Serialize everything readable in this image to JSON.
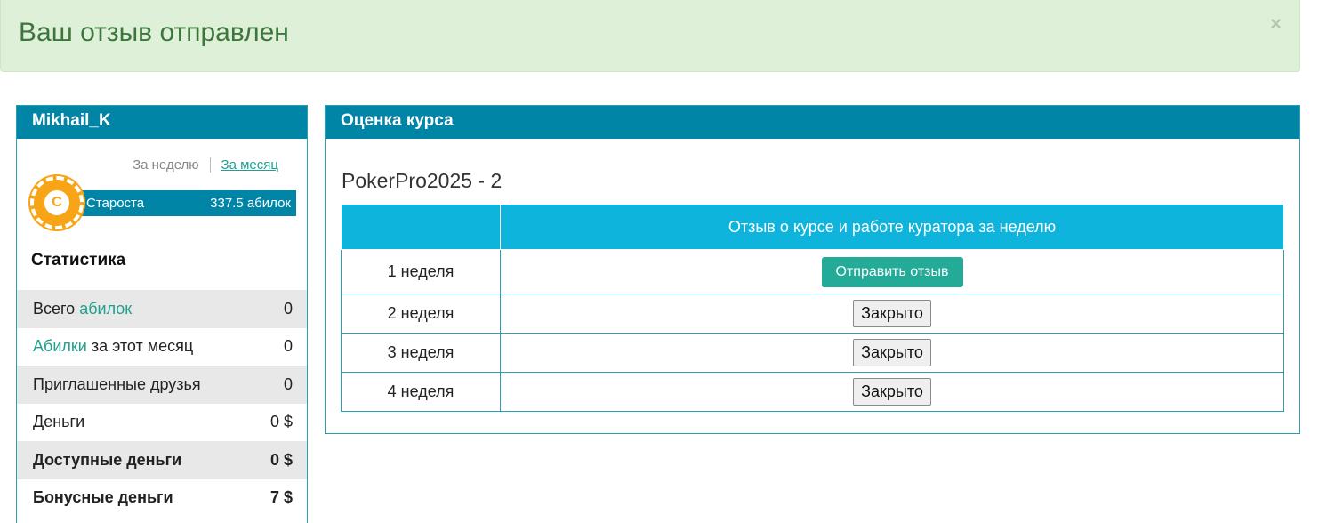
{
  "alert": {
    "message": "Ваш отзыв отправлен",
    "close": "×"
  },
  "user": {
    "name": "Mikhail_K",
    "period_tabs": {
      "week": "За неделю",
      "month": "За месяц"
    },
    "rank": {
      "badge_letter": "C",
      "title": "Староста",
      "points": "337.5 абилок"
    }
  },
  "stats": {
    "title": "Статистика",
    "rows": [
      {
        "label_prefix": "Всего ",
        "label_link": "абилок",
        "label_suffix": "",
        "value": "0"
      },
      {
        "label_prefix": "",
        "label_link": "Абилки",
        "label_suffix": " за этот месяц",
        "value": "0"
      },
      {
        "label": "Приглашенные друзья",
        "value": "0"
      },
      {
        "label": "Деньги",
        "value": "0 $"
      },
      {
        "label": "Доступные деньги",
        "value": "0 $"
      },
      {
        "label": "Бонусные деньги",
        "value": "7 $"
      }
    ]
  },
  "course": {
    "panel_title": "Оценка курса",
    "name": "PokerPro2025 - 2",
    "table_header": {
      "col1": "",
      "col2": "Отзыв о курсе и работе куратора за неделю"
    },
    "weeks": [
      {
        "label": "1 неделя",
        "action": "Отправить отзыв"
      },
      {
        "label": "2 неделя",
        "action": "Закрыто"
      },
      {
        "label": "3 неделя",
        "action": "Закрыто"
      },
      {
        "label": "4 неделя",
        "action": "Закрыто"
      }
    ]
  },
  "colors": {
    "accent": "#0085a6",
    "success_bg": "#dff0d8",
    "success_text": "#3c763d",
    "button_green": "#24ab97"
  }
}
